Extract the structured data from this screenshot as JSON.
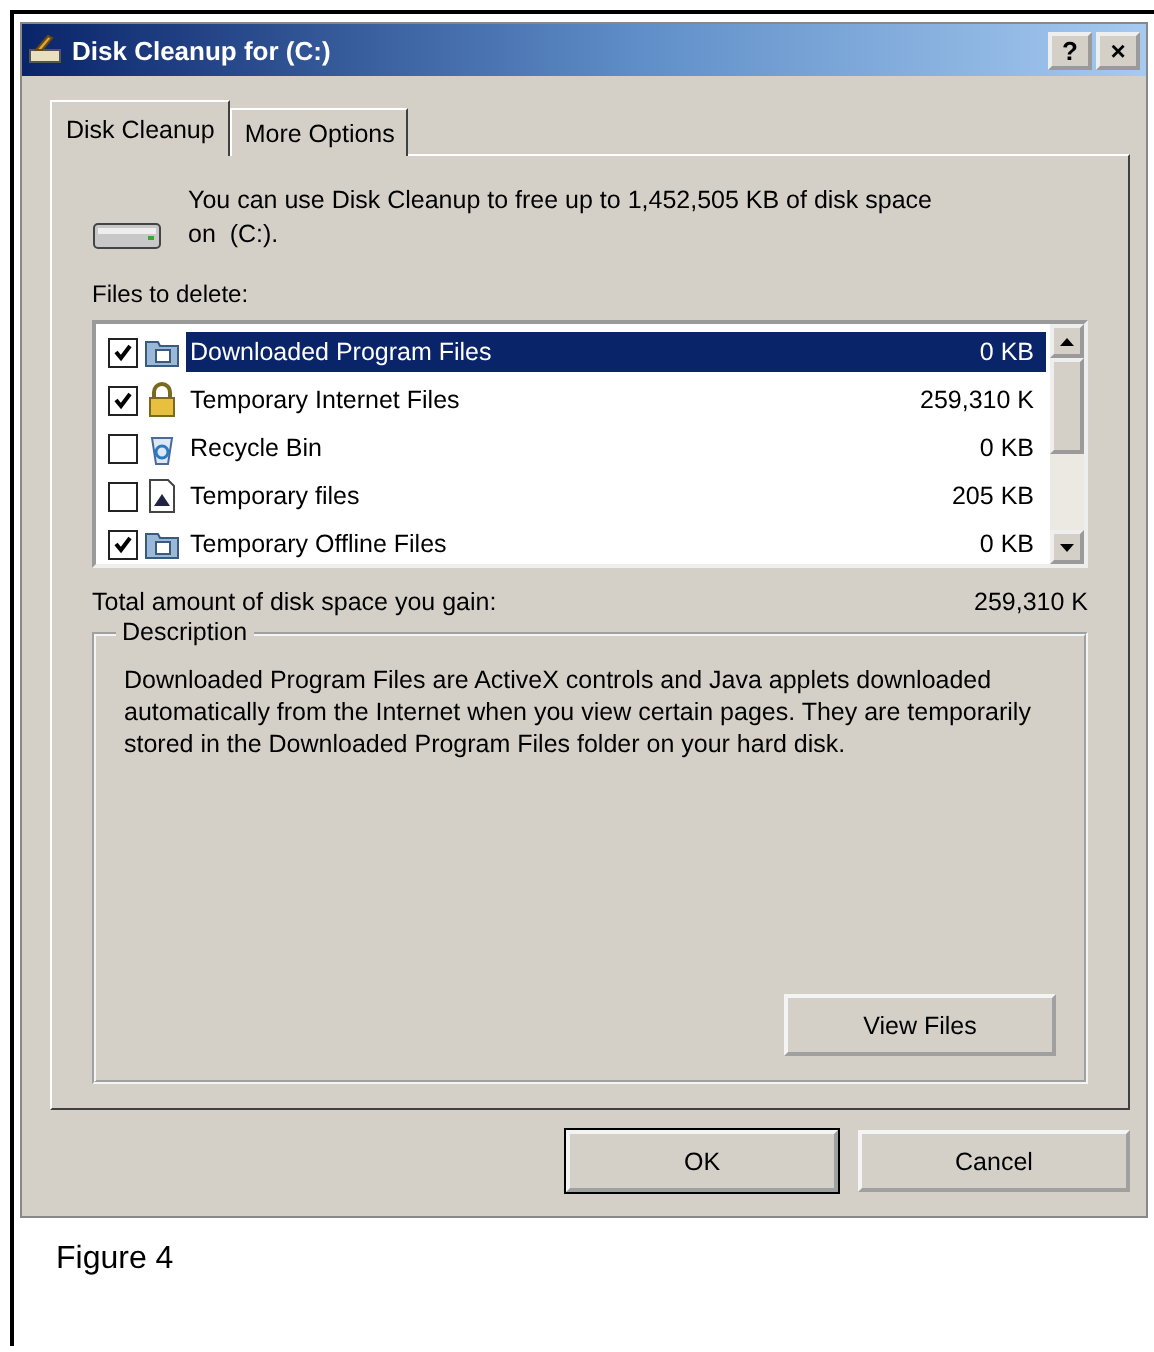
{
  "window": {
    "title": "Disk Cleanup for  (C:)",
    "title_buttons": [
      "?",
      "×"
    ]
  },
  "tabs": [
    {
      "label": "Disk Cleanup",
      "selected": true
    },
    {
      "label": "More Options",
      "selected": false
    }
  ],
  "intro": "You can use Disk Cleanup to free up to 1,452,505 KB of disk space on  (C:).",
  "files_label": "Files to delete:",
  "files": [
    {
      "name": "Downloaded Program Files",
      "size": "0 KB",
      "checked": true,
      "selected": true
    },
    {
      "name": "Temporary Internet Files",
      "size": "259,310 K",
      "checked": true,
      "selected": false
    },
    {
      "name": "Recycle Bin",
      "size": "0 KB",
      "checked": false,
      "selected": false
    },
    {
      "name": "Temporary files",
      "size": "205 KB",
      "checked": false,
      "selected": false
    },
    {
      "name": "Temporary Offline Files",
      "size": "0 KB",
      "checked": true,
      "selected": false
    }
  ],
  "total": {
    "label": "Total amount of disk space you gain:",
    "value": "259,310 K"
  },
  "description": {
    "legend": "Description",
    "text": "Downloaded Program Files are ActiveX controls and Java applets downloaded automatically from the Internet when you view certain pages. They are temporarily stored in the Downloaded Program Files folder on your hard disk.",
    "button": "View Files"
  },
  "buttons": [
    "OK",
    "Cancel"
  ],
  "caption": "Figure 4"
}
